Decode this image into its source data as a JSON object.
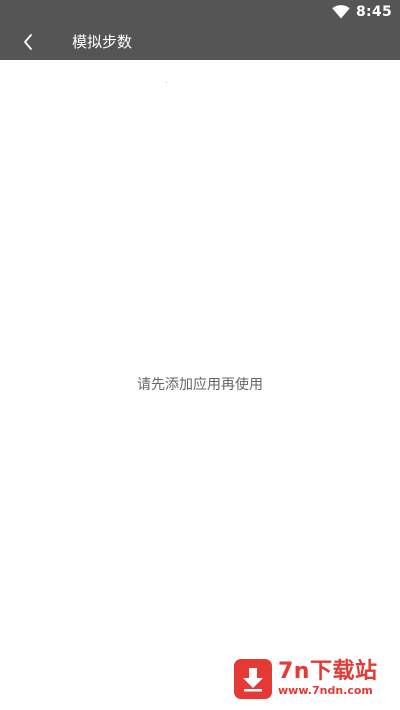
{
  "status_bar": {
    "time": "8:45",
    "wifi_icon": "wifi-icon"
  },
  "app_bar": {
    "back_icon": "chevron-left-icon",
    "title": "模拟步数"
  },
  "main": {
    "empty_message": "请先添加应用再使用"
  },
  "watermark": {
    "name": "7n下载站",
    "url": "www.7ndn.com",
    "logo_icon": "download-arrow-icon"
  },
  "colors": {
    "bar": "#555555",
    "background": "#ffffff",
    "message_text": "#666666",
    "watermark_red": "#e53935"
  }
}
